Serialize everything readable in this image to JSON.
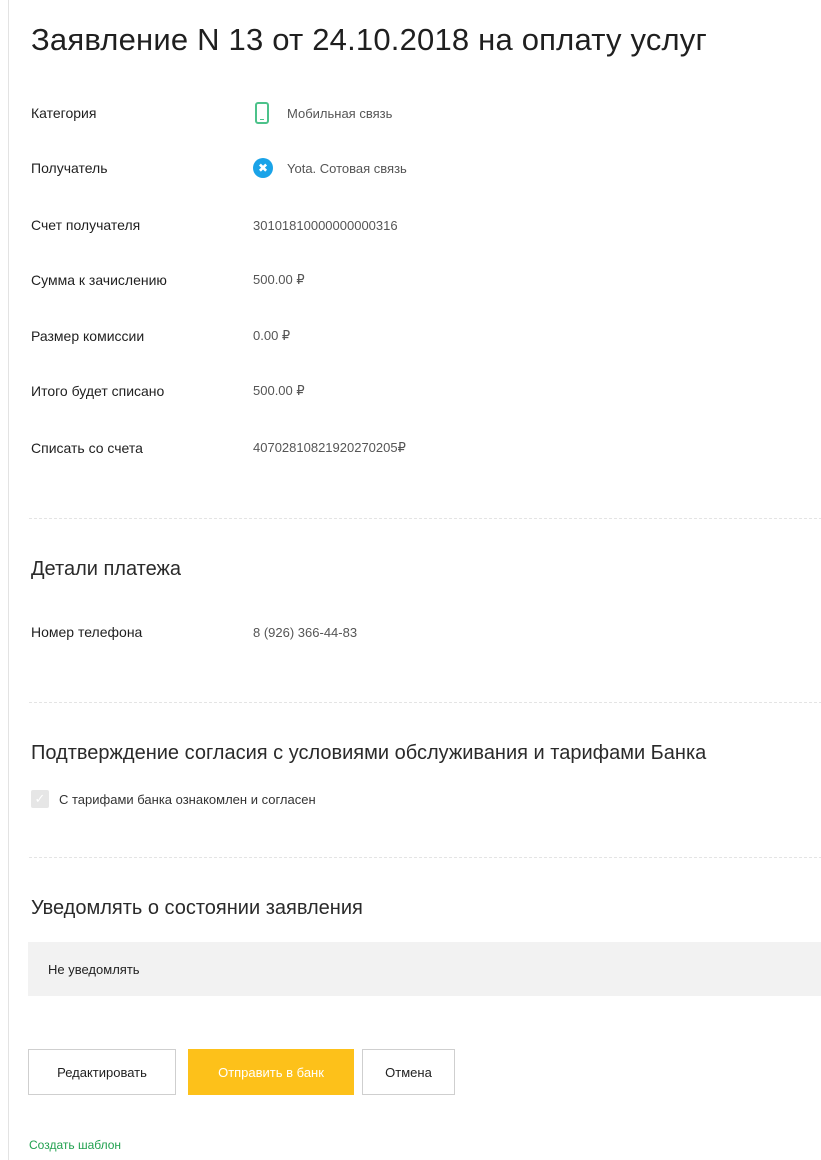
{
  "title": "Заявление N 13 от 24.10.2018 на оплату услуг",
  "fields": {
    "category": {
      "label": "Категория",
      "value": "Мобильная связь",
      "icon": "mobile-phone-icon"
    },
    "recipient": {
      "label": "Получатель",
      "value": "Yota. Сотовая связь",
      "icon": "yota-logo-icon"
    },
    "recipient_account": {
      "label": "Счет получателя",
      "value": "30101810000000000316"
    },
    "amount": {
      "label": "Сумма к зачислению",
      "value": "500.00 ₽"
    },
    "commission": {
      "label": "Размер комиссии",
      "value": "0.00 ₽"
    },
    "total": {
      "label": "Итого будет списано",
      "value": "500.00 ₽"
    },
    "debit_account": {
      "label": "Списать со счета",
      "value": "40702810821920270205₽"
    }
  },
  "payment_details": {
    "title": "Детали платежа",
    "phone": {
      "label": "Номер телефона",
      "value": "8 (926) 366-44-83"
    }
  },
  "consent": {
    "title": "Подтверждение согласия с условиями обслуживания и тарифами Банка",
    "checkbox_label": "С тарифами банка ознакомлен и согласен",
    "checked": true
  },
  "notify": {
    "title": "Уведомлять о состоянии заявления",
    "selected": "Не уведомлять"
  },
  "buttons": {
    "edit": "Редактировать",
    "send": "Отправить в банк",
    "cancel": "Отмена"
  },
  "links": {
    "create_template": "Создать шаблон"
  },
  "colors": {
    "accent": "#fdc11a",
    "link": "#21a14f",
    "category_icon": "#4cc28a",
    "recipient_icon": "#1aa3e8"
  }
}
